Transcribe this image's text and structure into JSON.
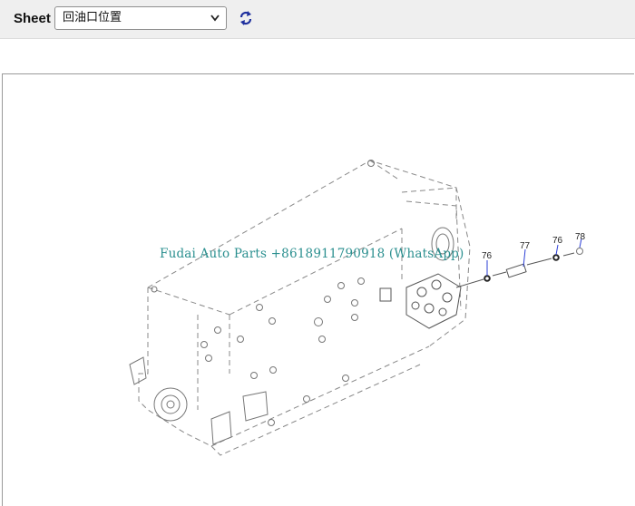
{
  "toolbar": {
    "sheet_label": "Sheet",
    "sheet_select_value": "回油口位置",
    "refresh_icon": "refresh-icon"
  },
  "drawing": {
    "watermark": "Fudai Auto Parts +8618911790918 (WhatsApp)",
    "callouts": [
      "76",
      "77",
      "76",
      "78"
    ]
  }
}
